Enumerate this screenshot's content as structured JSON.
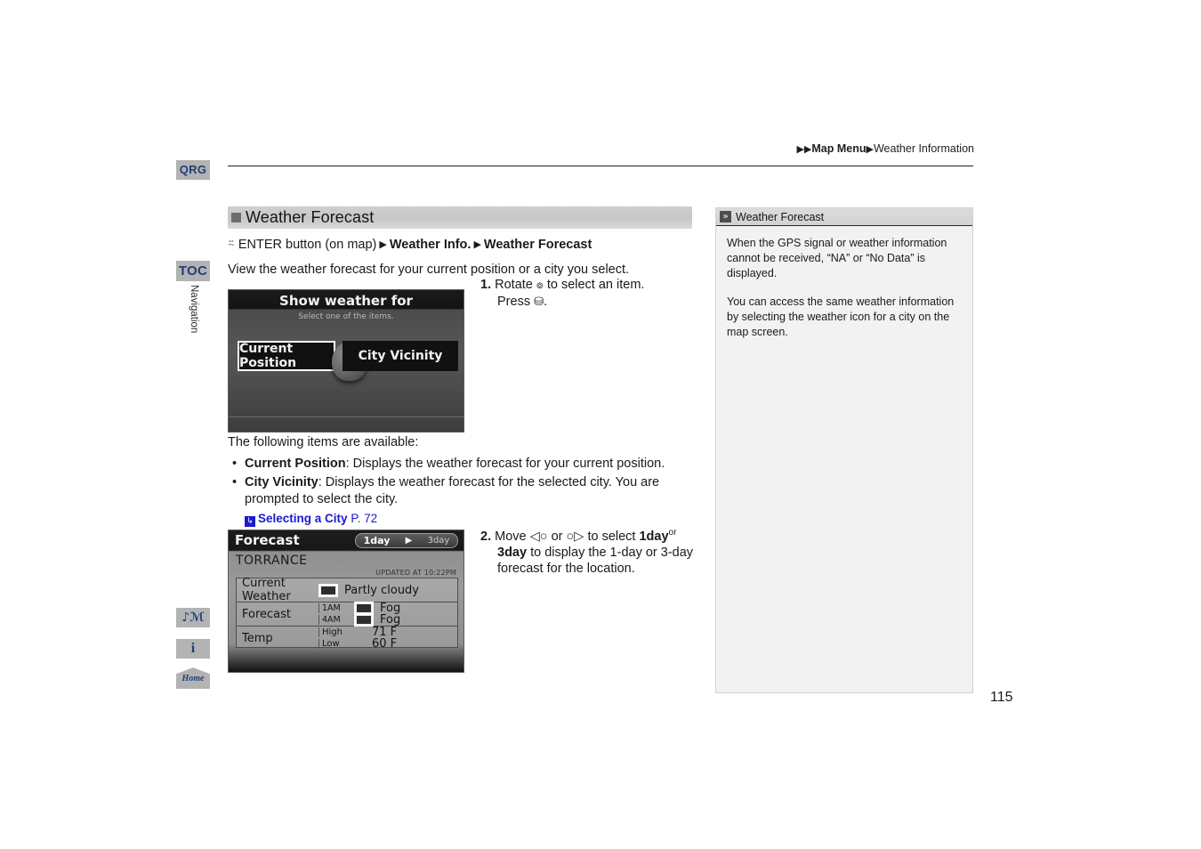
{
  "breadcrumb": {
    "arrow1": "▶",
    "arrow2": "▶",
    "crumb1": "Map Menu",
    "sep": "▶",
    "crumb2": "Weather Information"
  },
  "sidebar": {
    "qrg_label": "QRG",
    "toc_label": "TOC",
    "section_label": "Navigation",
    "symbol_icon": "♫⸢",
    "info_icon": "i",
    "home_label": "Home"
  },
  "section": {
    "heading": "Weather Forecast",
    "path": {
      "enter_icon": "⍨",
      "enter_text": "ENTER button (on map)",
      "tri1": "▶",
      "step1": "Weather Info.",
      "tri2": "▶",
      "step2": "Weather Forecast"
    },
    "intro": "View the weather forecast for your current position or a city you select."
  },
  "screen_show_weather": {
    "title": "Show weather for",
    "subtitle": "Select one of the items.",
    "option_left": "Current Position",
    "option_right": "City Vicinity"
  },
  "screen_forecast": {
    "title": "Forecast",
    "day_1": "1day",
    "day_arrow": "▶",
    "day_3": "3day",
    "city": "TORRANCE",
    "updated": "UPDATED AT 10:22PM",
    "rows": {
      "current_weather_label": "Current Weather",
      "current_weather_value": "Partly cloudy",
      "forecast_label": "Forecast",
      "forecast_time_1": "1AM",
      "forecast_value_1": "Fog",
      "forecast_time_2": "4AM",
      "forecast_value_2": "Fog",
      "temp_label": "Temp",
      "temp_high_label": "High",
      "temp_high_value": "71 F",
      "temp_low_label": "Low",
      "temp_low_value": "60 F"
    }
  },
  "steps": {
    "step1": {
      "num": "1.",
      "text_a": "Rotate ",
      "rotate_icon": "๏",
      "text_b": " to select an item.",
      "line2_a": "Press ",
      "press_icon": "⛁",
      "line2_b": "."
    },
    "step2": {
      "num": "2.",
      "text_a": "Move ",
      "left_icon": "◁○",
      "text_b": " or ",
      "right_icon": "○▷",
      "text_c": " to select ",
      "bold1": "1day",
      "sup": "or",
      "bold2": "3day",
      "text_d": " to display the 1-day or 3-day",
      "line3": "forecast for the location."
    }
  },
  "available": {
    "lead": "The following items are available:",
    "items": [
      {
        "term": "Current Position",
        "desc": ": Displays the weather forecast for your current position."
      },
      {
        "term": "City Vicinity",
        "desc": ": Displays the weather forecast for the selected city. You are prompted to select the city."
      }
    ],
    "xref_icon": "↳",
    "xref_title": "Selecting a City",
    "xref_page": "P. 72"
  },
  "note": {
    "icon": "»",
    "title": "Weather Forecast",
    "paragraph1": "When the GPS signal or weather information cannot be received, “NA” or “No Data” is displayed.",
    "paragraph2": "You can access the same weather information by selecting the weather icon for a city on the map screen."
  },
  "page_number": "115"
}
